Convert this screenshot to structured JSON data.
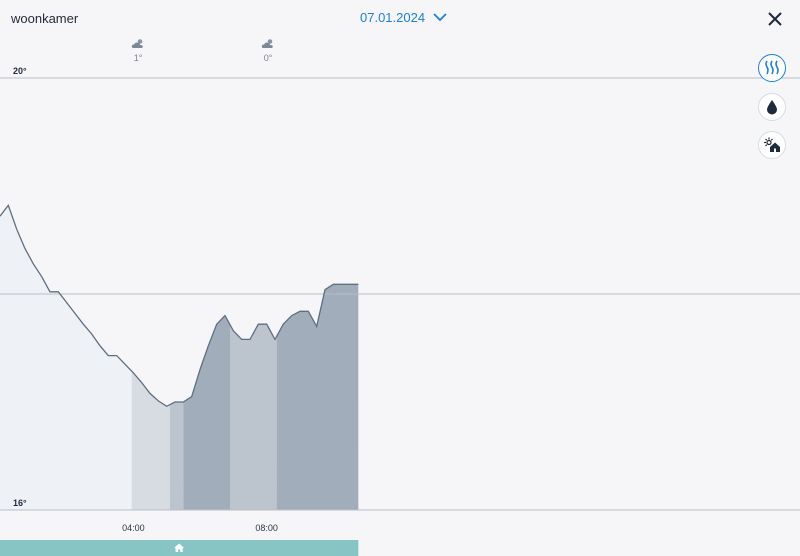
{
  "header": {
    "room_name": "woonkamer",
    "date": "07.01.2024"
  },
  "icons": {
    "date_dropdown": "chevron-down-icon",
    "close": "close-icon",
    "weather": "cloud-sun-icon",
    "heating": "heat-waves-icon",
    "humidity": "water-drop-icon",
    "outdoor": "sun-house-icon",
    "presence": "home-icon"
  },
  "weather": [
    {
      "time": "04:00",
      "temp": "1°"
    },
    {
      "time": "08:00",
      "temp": "0°"
    }
  ],
  "colors": {
    "accent": "#1a7fe0",
    "line": "#5f6e80",
    "presence_bar": "#87c4c4",
    "band_none": "#eef1f5",
    "band_low": "#d7dce3",
    "band_mid": "#bcc4ce",
    "band_high": "#a1adba"
  },
  "chart_data": {
    "type": "area",
    "x_unit": "hours",
    "xlim": [
      0,
      24
    ],
    "ylim": [
      16,
      20
    ],
    "y_ticks": [
      {
        "value": 20,
        "label": "20°"
      },
      {
        "value": 16,
        "label": "16°"
      }
    ],
    "gridlines": [
      20,
      18,
      16
    ],
    "x_ticks": [
      {
        "value": 4,
        "label": "04:00"
      },
      {
        "value": 8,
        "label": "08:00"
      }
    ],
    "series": [
      {
        "x": [
          0,
          0.25,
          0.5,
          0.75,
          1.0,
          1.25,
          1.5,
          1.75,
          2.0,
          2.25,
          2.5,
          2.75,
          3.0,
          3.25,
          3.5,
          3.75,
          4.0,
          4.25,
          4.5,
          4.75,
          5.0,
          5.25,
          5.5,
          5.75,
          6.0,
          6.25,
          6.5,
          6.75,
          7.0,
          7.25,
          7.5,
          7.75,
          8.0,
          8.25,
          8.5,
          8.75,
          9.0,
          9.25,
          9.5,
          9.75,
          10.0,
          10.25,
          10.5,
          10.75
        ],
        "y": [
          18.72,
          18.82,
          18.6,
          18.42,
          18.28,
          18.16,
          18.02,
          18.02,
          17.92,
          17.82,
          17.72,
          17.63,
          17.52,
          17.43,
          17.43,
          17.35,
          17.27,
          17.18,
          17.08,
          17.01,
          16.96,
          17.0,
          17.0,
          17.05,
          17.3,
          17.52,
          17.72,
          17.8,
          17.66,
          17.58,
          17.58,
          17.72,
          17.72,
          17.58,
          17.72,
          17.8,
          17.84,
          17.84,
          17.7,
          18.04,
          18.09,
          18.09,
          18.09,
          18.09
        ]
      }
    ],
    "bands": [
      {
        "from": 0,
        "to": 3.6,
        "level": "none"
      },
      {
        "from": 3.6,
        "to": 3.95,
        "level": "none"
      },
      {
        "from": 3.95,
        "to": 5.1,
        "level": "low"
      },
      {
        "from": 5.1,
        "to": 5.5,
        "level": "mid"
      },
      {
        "from": 5.5,
        "to": 6.9,
        "level": "high"
      },
      {
        "from": 6.9,
        "to": 8.3,
        "level": "mid"
      },
      {
        "from": 8.3,
        "to": 10.75,
        "level": "high"
      }
    ],
    "presence": {
      "from": 0,
      "to": 10.75
    }
  }
}
